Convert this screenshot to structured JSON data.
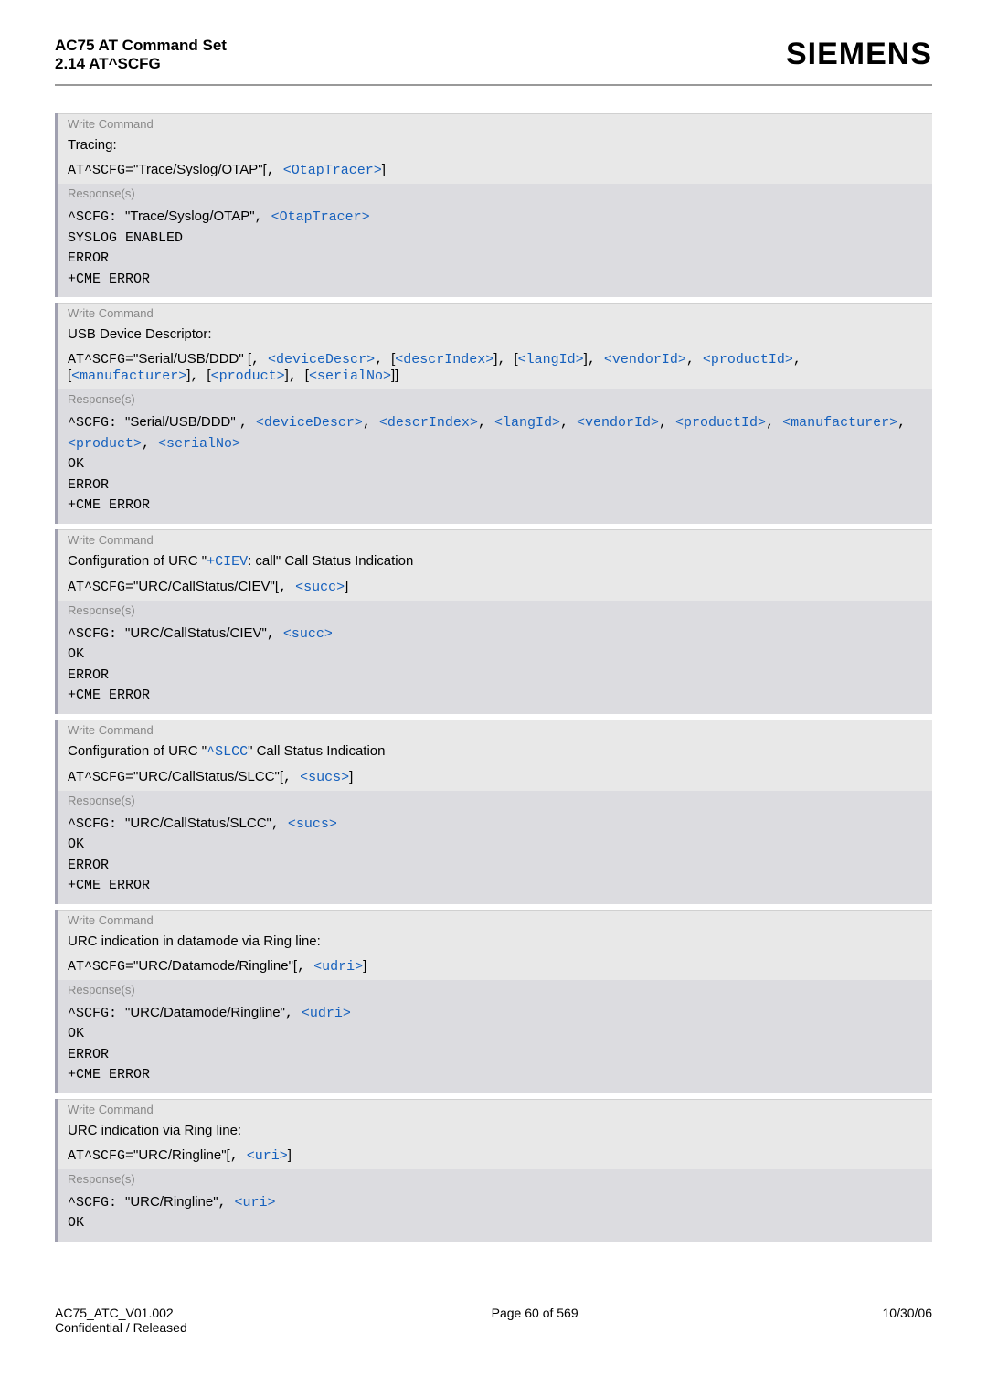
{
  "header": {
    "title": "AC75 AT Command Set",
    "sub": "2.14 AT^SCFG",
    "brand": "SIEMENS"
  },
  "labels": {
    "write_command": "Write Command",
    "response": "Response(s)"
  },
  "blocks": [
    {
      "desc_pre": "Tracing",
      "desc_link": "",
      "desc_post": ":",
      "cmd_parts": [
        {
          "t": "mono",
          "v": "AT^SCFG="
        },
        {
          "t": "sans",
          "v": "\"Trace/Syslog/OTAP\"["
        },
        {
          "t": "mono",
          "v": ", "
        },
        {
          "t": "param",
          "v": "<OtapTracer>"
        },
        {
          "t": "sans",
          "v": "]"
        }
      ],
      "resp_lines": [
        [
          {
            "t": "mono",
            "v": "^SCFG: "
          },
          {
            "t": "sans",
            "v": "\"Trace/Syslog/OTAP\""
          },
          {
            "t": "mono",
            "v": ", "
          },
          {
            "t": "param",
            "v": "<OtapTracer>"
          }
        ],
        [
          {
            "t": "mono",
            "v": "SYSLOG ENABLED"
          }
        ],
        [
          {
            "t": "mono",
            "v": "ERROR"
          }
        ],
        [
          {
            "t": "mono",
            "v": "+CME ERROR"
          }
        ]
      ]
    },
    {
      "desc_pre": "USB Device Descriptor:",
      "desc_link": "",
      "desc_post": "",
      "cmd_parts": [
        {
          "t": "mono",
          "v": "AT^SCFG="
        },
        {
          "t": "sans",
          "v": "\"Serial/USB/DDD\" ["
        },
        {
          "t": "mono",
          "v": ", "
        },
        {
          "t": "param",
          "v": "<deviceDescr>"
        },
        {
          "t": "mono",
          "v": ", "
        },
        {
          "t": "sans",
          "v": "["
        },
        {
          "t": "param",
          "v": "<descrIndex>"
        },
        {
          "t": "sans",
          "v": "]"
        },
        {
          "t": "mono",
          "v": ", "
        },
        {
          "t": "sans",
          "v": "["
        },
        {
          "t": "param",
          "v": "<langId>"
        },
        {
          "t": "sans",
          "v": "]"
        },
        {
          "t": "mono",
          "v": ", "
        },
        {
          "t": "param",
          "v": "<vendorId>"
        },
        {
          "t": "mono",
          "v": ", "
        },
        {
          "t": "param",
          "v": "<productId>"
        },
        {
          "t": "mono",
          "v": ", "
        },
        {
          "t": "sans",
          "v": "["
        },
        {
          "t": "param",
          "v": "<manufacturer>"
        },
        {
          "t": "sans",
          "v": "]"
        },
        {
          "t": "mono",
          "v": ", "
        },
        {
          "t": "sans",
          "v": "["
        },
        {
          "t": "param",
          "v": "<product>"
        },
        {
          "t": "sans",
          "v": "]"
        },
        {
          "t": "mono",
          "v": ", "
        },
        {
          "t": "sans",
          "v": "["
        },
        {
          "t": "param",
          "v": "<serialNo>"
        },
        {
          "t": "sans",
          "v": "]]"
        }
      ],
      "resp_lines": [
        [
          {
            "t": "mono",
            "v": "^SCFG: "
          },
          {
            "t": "sans",
            "v": "\"Serial/USB/DDD\" "
          },
          {
            "t": "mono",
            "v": ", "
          },
          {
            "t": "param",
            "v": "<deviceDescr>"
          },
          {
            "t": "mono",
            "v": ", "
          },
          {
            "t": "param",
            "v": "<descrIndex>"
          },
          {
            "t": "mono",
            "v": ", "
          },
          {
            "t": "param",
            "v": "<langId>"
          },
          {
            "t": "mono",
            "v": ", "
          },
          {
            "t": "param",
            "v": "<vendorId>"
          },
          {
            "t": "mono",
            "v": ", "
          },
          {
            "t": "param",
            "v": "<productId>"
          },
          {
            "t": "mono",
            "v": ", "
          },
          {
            "t": "param",
            "v": "<manufacturer>"
          },
          {
            "t": "mono",
            "v": ", "
          },
          {
            "t": "param",
            "v": "<product>"
          },
          {
            "t": "mono",
            "v": ", "
          },
          {
            "t": "param",
            "v": "<serialNo>"
          }
        ],
        [
          {
            "t": "mono",
            "v": "OK"
          }
        ],
        [
          {
            "t": "mono",
            "v": "ERROR"
          }
        ],
        [
          {
            "t": "mono",
            "v": "+CME ERROR"
          }
        ]
      ]
    },
    {
      "desc_parts": [
        {
          "t": "sans",
          "v": "Configuration of URC \""
        },
        {
          "t": "param",
          "v": "+CIEV"
        },
        {
          "t": "sans",
          "v": ": call\" Call Status Indication"
        }
      ],
      "cmd_parts": [
        {
          "t": "mono",
          "v": "AT^SCFG="
        },
        {
          "t": "sans",
          "v": "\"URC/CallStatus/CIEV\"["
        },
        {
          "t": "mono",
          "v": ", "
        },
        {
          "t": "param",
          "v": "<succ>"
        },
        {
          "t": "sans",
          "v": "]"
        }
      ],
      "resp_lines": [
        [
          {
            "t": "mono",
            "v": "^SCFG: "
          },
          {
            "t": "sans",
            "v": "\"URC/CallStatus/CIEV\""
          },
          {
            "t": "mono",
            "v": ", "
          },
          {
            "t": "param",
            "v": "<succ>"
          }
        ],
        [
          {
            "t": "mono",
            "v": "OK"
          }
        ],
        [
          {
            "t": "mono",
            "v": "ERROR"
          }
        ],
        [
          {
            "t": "mono",
            "v": "+CME ERROR"
          }
        ]
      ]
    },
    {
      "desc_parts": [
        {
          "t": "sans",
          "v": "Configuration of URC \""
        },
        {
          "t": "param",
          "v": "^SLCC"
        },
        {
          "t": "sans",
          "v": "\" Call Status Indication"
        }
      ],
      "cmd_parts": [
        {
          "t": "mono",
          "v": "AT^SCFG="
        },
        {
          "t": "sans",
          "v": "\"URC/CallStatus/SLCC\"["
        },
        {
          "t": "mono",
          "v": ", "
        },
        {
          "t": "param",
          "v": "<sucs>"
        },
        {
          "t": "sans",
          "v": "]"
        }
      ],
      "resp_lines": [
        [
          {
            "t": "mono",
            "v": "^SCFG: "
          },
          {
            "t": "sans",
            "v": "\"URC/CallStatus/SLCC\""
          },
          {
            "t": "mono",
            "v": ", "
          },
          {
            "t": "param",
            "v": "<sucs>"
          }
        ],
        [
          {
            "t": "mono",
            "v": "OK"
          }
        ],
        [
          {
            "t": "mono",
            "v": "ERROR"
          }
        ],
        [
          {
            "t": "mono",
            "v": "+CME ERROR"
          }
        ]
      ]
    },
    {
      "desc_pre": "URC indication in datamode via Ring line:",
      "desc_link": "",
      "desc_post": "",
      "cmd_parts": [
        {
          "t": "mono",
          "v": "AT^SCFG="
        },
        {
          "t": "sans",
          "v": "\"URC/Datamode/Ringline\"["
        },
        {
          "t": "mono",
          "v": ", "
        },
        {
          "t": "param",
          "v": "<udri>"
        },
        {
          "t": "sans",
          "v": "]"
        }
      ],
      "resp_lines": [
        [
          {
            "t": "mono",
            "v": "^SCFG: "
          },
          {
            "t": "sans",
            "v": "\"URC/Datamode/Ringline\""
          },
          {
            "t": "mono",
            "v": ", "
          },
          {
            "t": "param",
            "v": "<udri>"
          }
        ],
        [
          {
            "t": "mono",
            "v": "OK"
          }
        ],
        [
          {
            "t": "mono",
            "v": "ERROR"
          }
        ],
        [
          {
            "t": "mono",
            "v": "+CME ERROR"
          }
        ]
      ]
    },
    {
      "desc_pre": "URC indication via Ring line:",
      "desc_link": "",
      "desc_post": "",
      "cmd_parts": [
        {
          "t": "mono",
          "v": "AT^SCFG="
        },
        {
          "t": "sans",
          "v": "\"URC/Ringline\"["
        },
        {
          "t": "mono",
          "v": ", "
        },
        {
          "t": "param",
          "v": "<uri>"
        },
        {
          "t": "sans",
          "v": "]"
        }
      ],
      "resp_lines": [
        [
          {
            "t": "mono",
            "v": "^SCFG: "
          },
          {
            "t": "sans",
            "v": "\"URC/Ringline\""
          },
          {
            "t": "mono",
            "v": ", "
          },
          {
            "t": "param",
            "v": "<uri>"
          }
        ],
        [
          {
            "t": "mono",
            "v": "OK"
          }
        ]
      ]
    }
  ],
  "footer": {
    "left1": "AC75_ATC_V01.002",
    "left2": "Confidential / Released",
    "center": "Page 60 of 569",
    "right": "10/30/06"
  }
}
